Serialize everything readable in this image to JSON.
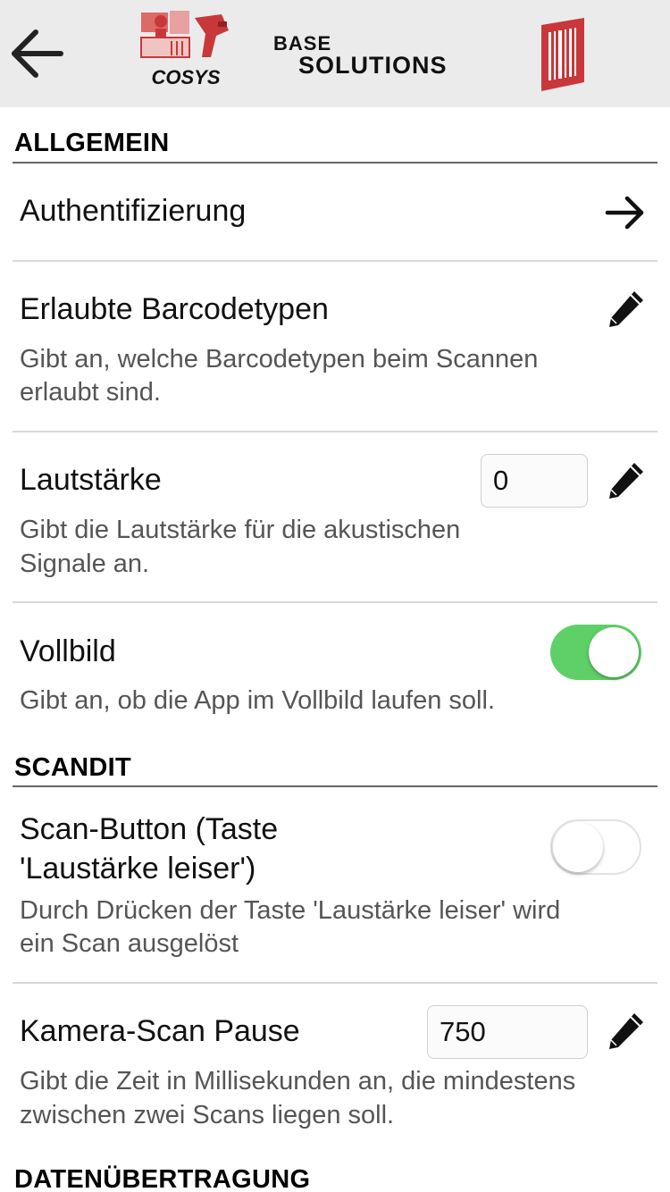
{
  "header": {
    "logo_cosys_text": "COSYS",
    "logo_base_line1": "BASE",
    "logo_base_line2": "SOLUTIONS"
  },
  "sections": {
    "allgemein": "ALLGEMEIN",
    "scandit": "SCANDIT",
    "datenuebertragung": "DATENÜBERTRAGUNG"
  },
  "settings": {
    "authentifizierung": {
      "title": "Authentifizierung"
    },
    "barcodetypen": {
      "title": "Erlaubte Barcodetypen",
      "desc1": "Gibt an, welche Barcodetypen beim Scannen",
      "desc2": "erlaubt sind."
    },
    "lautstaerke": {
      "title": "Lautstärke",
      "value": "0",
      "desc1": "Gibt die Lautstärke für die akustischen",
      "desc2": "Signale an."
    },
    "vollbild": {
      "title": "Vollbild",
      "enabled": true,
      "desc1": "Gibt an, ob die App im Vollbild laufen soll."
    },
    "scan_button": {
      "title1": "Scan-Button (Taste",
      "title2": "'Laustärke leiser')",
      "enabled": false,
      "desc1": "Durch Drücken der Taste 'Laustärke leiser' wird",
      "desc2": "ein Scan ausgelöst"
    },
    "kamera_pause": {
      "title": "Kamera-Scan Pause",
      "value": "750",
      "desc1": "Gibt die Zeit in Millisekunden an, die mindestens",
      "desc2": "zwischen zwei Scans liegen soll."
    }
  },
  "colors": {
    "toggle_on": "#5fd068",
    "brand_red": "#c8383a",
    "header_bg": "#ebebeb"
  }
}
